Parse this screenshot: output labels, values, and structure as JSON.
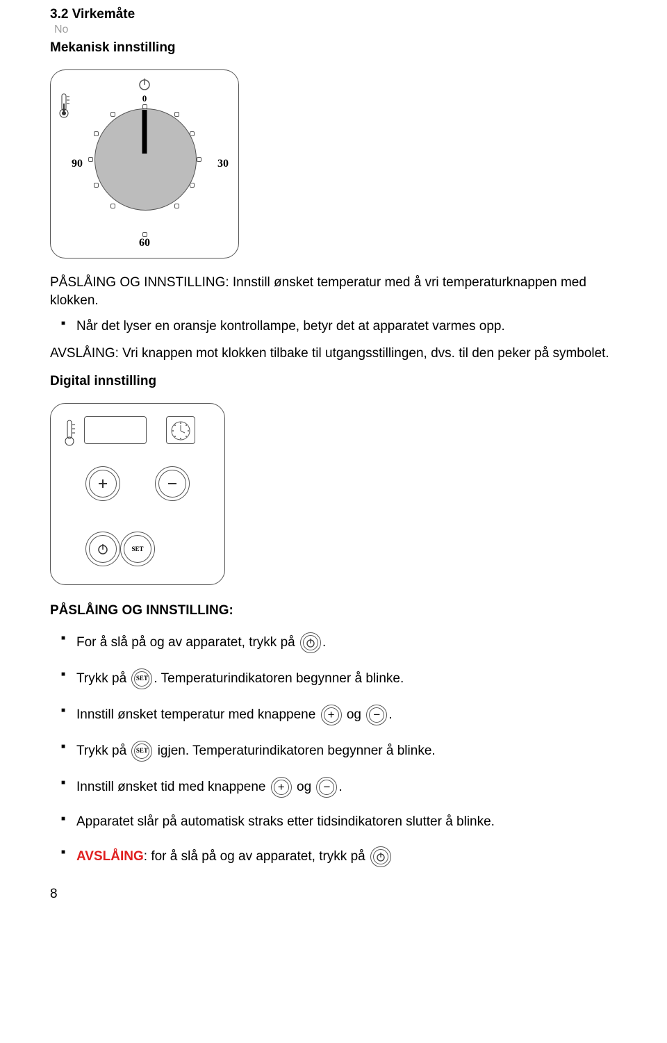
{
  "section_number": "3.2 Virkemåte",
  "lang_tag": "No",
  "subheading1": "Mekanisk innstilling",
  "dial": {
    "zero": "0",
    "v30": "30",
    "v60": "60",
    "v90": "90"
  },
  "mech_intro": "PÅSLÅING OG INNSTILLING: Innstill ønsket temperatur med å vri temperaturknappen med klokken.",
  "mech_bullets": [
    "Når det lyser en oransje kontrollampe, betyr det at apparatet varmes opp."
  ],
  "mech_off": "AVSLÅING: Vri knappen mot klokken tilbake til utgangsstillingen, dvs. til den peker på symbolet.",
  "subheading2": "Digital innstilling",
  "dig_heading": "PÅSLÅING OG INNSTILLING:",
  "dig_bullets": {
    "b1_pre": "For å slå på og av apparatet, trykk på ",
    "b1_post": ".",
    "b2_pre": "Trykk på ",
    "b2_post": ". Temperaturindikatoren begynner å blinke.",
    "b3_pre": "Innstill ønsket temperatur med knappene ",
    "b3_mid": "og ",
    "b3_post": ".",
    "b4_pre": "Trykk på ",
    "b4_post": " igjen. Temperaturindikatoren begynner å blinke.",
    "b5_pre": "Innstill ønsket tid med knappene ",
    "b5_mid": " og ",
    "b5_post": ".",
    "b6": "Apparatet slår på automatisk straks etter tidsindikatoren slutter å blinke.",
    "b7_label": "AVSLÅING",
    "b7_rest": ": for å slå på og av apparatet, trykk på"
  },
  "icons": {
    "set": "SET"
  },
  "page_num": "8"
}
